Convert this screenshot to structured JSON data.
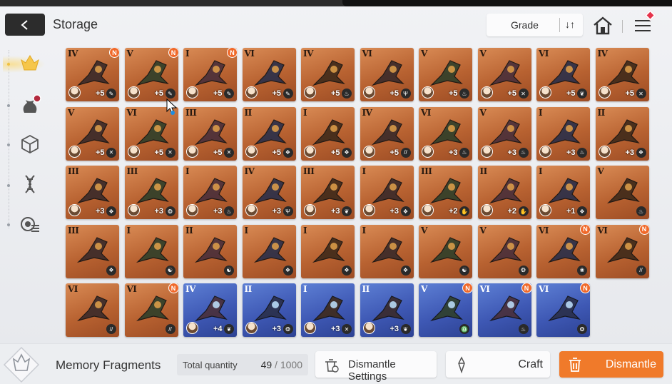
{
  "header": {
    "title": "Storage",
    "back_icon": "back-arrow-icon",
    "sort": {
      "label": "Grade",
      "icon": "sort-toggle-icon"
    },
    "home_icon": "home-icon",
    "menu_icon": "menu-icon"
  },
  "sidebar": {
    "tabs": [
      {
        "name": "memory-fragment-tab-icon",
        "active": true
      },
      {
        "name": "pouch-tab-icon",
        "active": false
      },
      {
        "name": "cube-tab-icon",
        "active": false
      },
      {
        "name": "dna-tab-icon",
        "active": false
      },
      {
        "name": "gear-list-tab-icon",
        "active": false
      }
    ]
  },
  "items": [
    {
      "grade": "IV",
      "plus": "+5",
      "new": "N",
      "rarity": "orange",
      "type": "✎"
    },
    {
      "grade": "V",
      "plus": "+5",
      "new": "N",
      "rarity": "orange",
      "type": "✎"
    },
    {
      "grade": "I",
      "plus": "+5",
      "new": "N",
      "rarity": "orange",
      "type": "✎"
    },
    {
      "grade": "VI",
      "plus": "+5",
      "new": "",
      "rarity": "orange",
      "type": "✎"
    },
    {
      "grade": "IV",
      "plus": "+5",
      "new": "",
      "rarity": "orange",
      "type": "♨"
    },
    {
      "grade": "VI",
      "plus": "+5",
      "new": "",
      "rarity": "orange",
      "type": "Ψ"
    },
    {
      "grade": "V",
      "plus": "+5",
      "new": "",
      "rarity": "orange",
      "type": "♨"
    },
    {
      "grade": "V",
      "plus": "+5",
      "new": "",
      "rarity": "orange",
      "type": "✕"
    },
    {
      "grade": "VI",
      "plus": "+5",
      "new": "",
      "rarity": "orange",
      "type": "❦"
    },
    {
      "grade": "IV",
      "plus": "+5",
      "new": "",
      "rarity": "orange",
      "type": "✕"
    },
    {
      "grade": "V",
      "plus": "+5",
      "new": "",
      "rarity": "orange",
      "type": "✕"
    },
    {
      "grade": "VI",
      "plus": "+5",
      "new": "",
      "rarity": "orange",
      "type": "✕"
    },
    {
      "grade": "III",
      "plus": "+5",
      "new": "",
      "rarity": "orange",
      "type": "✕"
    },
    {
      "grade": "II",
      "plus": "+5",
      "new": "",
      "rarity": "orange",
      "type": "❖"
    },
    {
      "grade": "I",
      "plus": "+5",
      "new": "",
      "rarity": "orange",
      "type": "❖"
    },
    {
      "grade": "IV",
      "plus": "+5",
      "new": "",
      "rarity": "orange",
      "type": "//"
    },
    {
      "grade": "VI",
      "plus": "+3",
      "new": "",
      "rarity": "orange",
      "type": "♨"
    },
    {
      "grade": "V",
      "plus": "+3",
      "new": "",
      "rarity": "orange",
      "type": "♨"
    },
    {
      "grade": "I",
      "plus": "+3",
      "new": "",
      "rarity": "orange",
      "type": "♨"
    },
    {
      "grade": "II",
      "plus": "+3",
      "new": "",
      "rarity": "orange",
      "type": "❖"
    },
    {
      "grade": "III",
      "plus": "+3",
      "new": "",
      "rarity": "orange",
      "type": "❖"
    },
    {
      "grade": "III",
      "plus": "+3",
      "new": "",
      "rarity": "orange",
      "type": "❂"
    },
    {
      "grade": "I",
      "plus": "+3",
      "new": "",
      "rarity": "orange",
      "type": "♨"
    },
    {
      "grade": "IV",
      "plus": "+3",
      "new": "",
      "rarity": "orange",
      "type": "Ψ"
    },
    {
      "grade": "III",
      "plus": "+3",
      "new": "",
      "rarity": "orange",
      "type": "❦"
    },
    {
      "grade": "I",
      "plus": "+3",
      "new": "",
      "rarity": "orange",
      "type": "❖"
    },
    {
      "grade": "III",
      "plus": "+2",
      "new": "",
      "rarity": "orange",
      "type": "✋"
    },
    {
      "grade": "II",
      "plus": "+2",
      "new": "",
      "rarity": "orange",
      "type": "✋"
    },
    {
      "grade": "I",
      "plus": "+1",
      "new": "",
      "rarity": "orange",
      "type": "❖"
    },
    {
      "grade": "V",
      "plus": "",
      "new": "",
      "rarity": "orange",
      "type": "♨"
    },
    {
      "grade": "III",
      "plus": "",
      "new": "",
      "rarity": "orange",
      "type": "❖"
    },
    {
      "grade": "I",
      "plus": "",
      "new": "",
      "rarity": "orange",
      "type": "☯"
    },
    {
      "grade": "II",
      "plus": "",
      "new": "",
      "rarity": "orange",
      "type": "☯"
    },
    {
      "grade": "I",
      "plus": "",
      "new": "",
      "rarity": "orange",
      "type": "❖"
    },
    {
      "grade": "I",
      "plus": "",
      "new": "",
      "rarity": "orange",
      "type": "❖"
    },
    {
      "grade": "I",
      "plus": "",
      "new": "",
      "rarity": "orange",
      "type": "❖"
    },
    {
      "grade": "V",
      "plus": "",
      "new": "",
      "rarity": "orange",
      "type": "☯"
    },
    {
      "grade": "V",
      "plus": "",
      "new": "",
      "rarity": "orange",
      "type": "❂"
    },
    {
      "grade": "VI",
      "plus": "",
      "new": "N",
      "rarity": "orange",
      "type": "❀"
    },
    {
      "grade": "VI",
      "plus": "",
      "new": "N",
      "rarity": "orange",
      "type": "//"
    },
    {
      "grade": "VI",
      "plus": "",
      "new": "",
      "rarity": "orange",
      "type": "//"
    },
    {
      "grade": "VI",
      "plus": "",
      "new": "N",
      "rarity": "orange",
      "type": "//"
    },
    {
      "grade": "IV",
      "plus": "+4",
      "new": "",
      "rarity": "blue",
      "type": "❦"
    },
    {
      "grade": "II",
      "plus": "+3",
      "new": "",
      "rarity": "blue",
      "type": "❂"
    },
    {
      "grade": "I",
      "plus": "+3",
      "new": "",
      "rarity": "blue",
      "type": "✕"
    },
    {
      "grade": "II",
      "plus": "+3",
      "new": "",
      "rarity": "blue",
      "type": "❦"
    },
    {
      "grade": "V",
      "plus": "",
      "new": "N",
      "rarity": "blue",
      "type": "♎"
    },
    {
      "grade": "VI",
      "plus": "",
      "new": "N",
      "rarity": "blue",
      "type": "♨"
    },
    {
      "grade": "VI",
      "plus": "",
      "new": "N",
      "rarity": "blue",
      "type": "❂"
    }
  ],
  "footer": {
    "fragments_label": "Memory Fragments",
    "total_label": "Total quantity",
    "current": "49",
    "separator": " / ",
    "max": "1000",
    "dismantle_settings_label": "Dismantle Settings",
    "craft_label": "Craft",
    "dismantle_label": "Dismantle"
  },
  "colors": {
    "accent_orange": "#f07a2a",
    "card_orange": "#b86231",
    "card_blue": "#3e58b4",
    "new_badge": "#f0692a",
    "menu_badge": "#e5334b"
  }
}
